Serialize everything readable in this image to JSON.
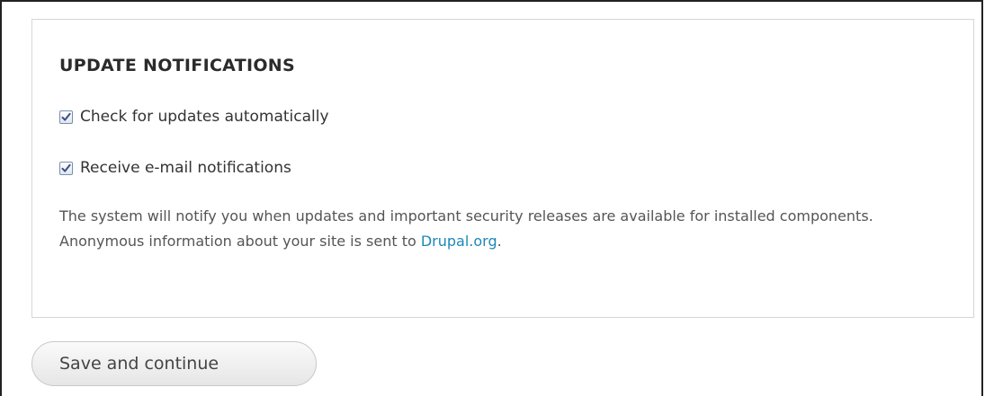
{
  "update_notifications": {
    "title": "UPDATE NOTIFICATIONS",
    "options": [
      {
        "label": "Check for updates automatically",
        "checked": true
      },
      {
        "label": "Receive e-mail notifications",
        "checked": true
      }
    ],
    "description_text": "The system will notify you when updates and important security releases are available for installed components. Anonymous information about your site is sent to ",
    "description_link": "Drupal.org",
    "description_end": "."
  },
  "actions": {
    "save_label": "Save and continue"
  },
  "colors": {
    "link": "#1d87b8",
    "checkmark": "#3a4f8a",
    "fieldset_border": "#d6d6d6"
  }
}
